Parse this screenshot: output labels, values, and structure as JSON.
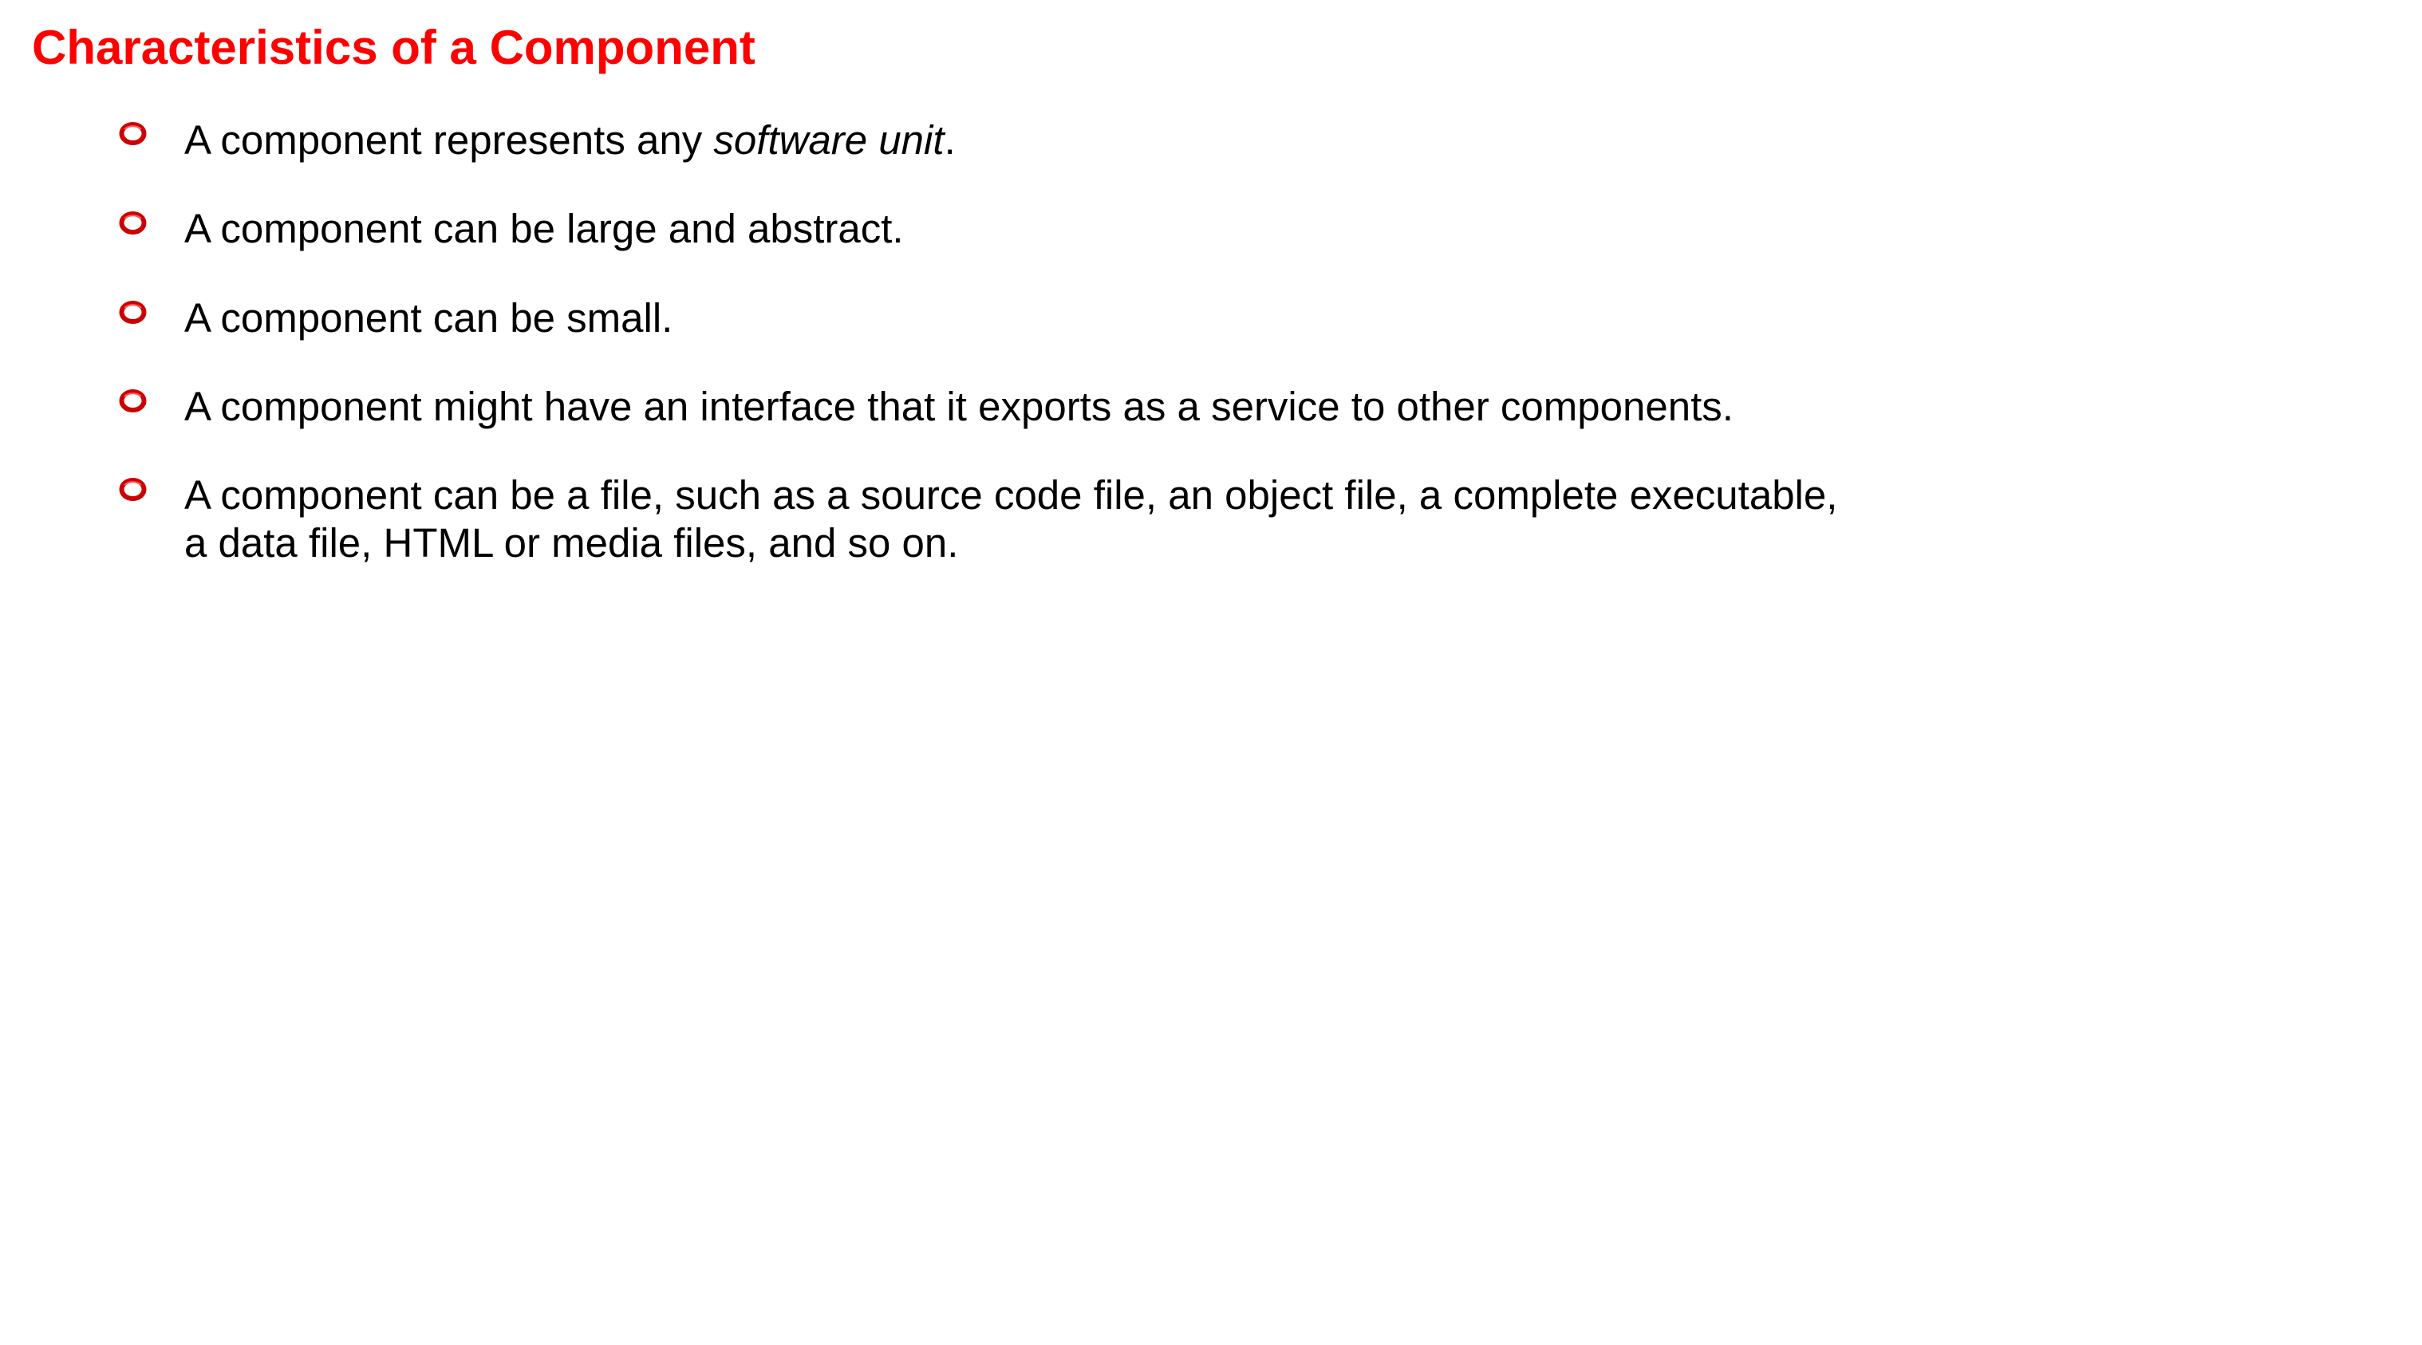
{
  "colors": {
    "title": "#ff0000",
    "text": "#000000",
    "bullet_ring": "#cc0000",
    "bullet_ring_highlight": "#ff5a5a"
  },
  "slide": {
    "title": "Characteristics of a Component",
    "bullet_icon": "red-ring-icon",
    "bullets": [
      {
        "parts": [
          "A component represents any ",
          "software unit",
          "."
        ],
        "italic_part": "software unit"
      },
      {
        "text": "A component can be large and abstract."
      },
      {
        "text": "A component can be small."
      },
      {
        "text": "A component might have an interface that it exports as a service to other components."
      },
      {
        "lines": [
          "A component can be a file, such as a source code file, an object file, a complete executable,",
          "a data file, HTML or media files, and so on."
        ]
      }
    ]
  }
}
